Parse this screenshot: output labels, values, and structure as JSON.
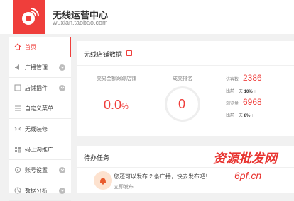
{
  "header": {
    "title": "无线运营中心",
    "url": "wuxian.taobao.com",
    "brand_color": "#ef3e3b"
  },
  "sidebar": {
    "items": [
      {
        "label": "首页",
        "icon": "home-icon",
        "active": true,
        "expandable": false
      },
      {
        "label": "广播管理",
        "icon": "broadcast-icon",
        "active": false,
        "expandable": true
      },
      {
        "label": "店铺插件",
        "icon": "plugin-icon",
        "active": false,
        "expandable": true
      },
      {
        "label": "自定义菜单",
        "icon": "menu-icon",
        "active": false,
        "expandable": false
      },
      {
        "label": "无线装修",
        "icon": "decorate-icon",
        "active": false,
        "expandable": false
      },
      {
        "label": "码上淘推广",
        "icon": "qrcode-icon",
        "active": false,
        "expandable": false
      },
      {
        "label": "账号设置",
        "icon": "settings-icon",
        "active": false,
        "expandable": true
      },
      {
        "label": "数据分析",
        "icon": "chart-icon",
        "active": false,
        "expandable": true
      }
    ]
  },
  "dashboard": {
    "title": "无线店铺数据",
    "conversion_label": "交易金额跟踪店铺",
    "conversion_value": "0.0",
    "conversion_unit": "%",
    "rank_label": "成交排名",
    "rank_value": "0",
    "visitors_label": "访客数",
    "visitors_value": "2386",
    "visitors_compare_label": "比前一天",
    "visitors_compare_value": "10%",
    "pageviews_label": "浏览量",
    "pageviews_value": "6968",
    "pageviews_compare_label": "比前一天",
    "pageviews_compare_value": "8%",
    "up_arrow": "↑"
  },
  "todo": {
    "title": "待办任务",
    "message": "您还可以发布 2 条广播，快去发布吧！",
    "sub_message": "立即发布"
  },
  "watermark": {
    "line1": "资源批发网",
    "line2": "6pf.cn"
  }
}
